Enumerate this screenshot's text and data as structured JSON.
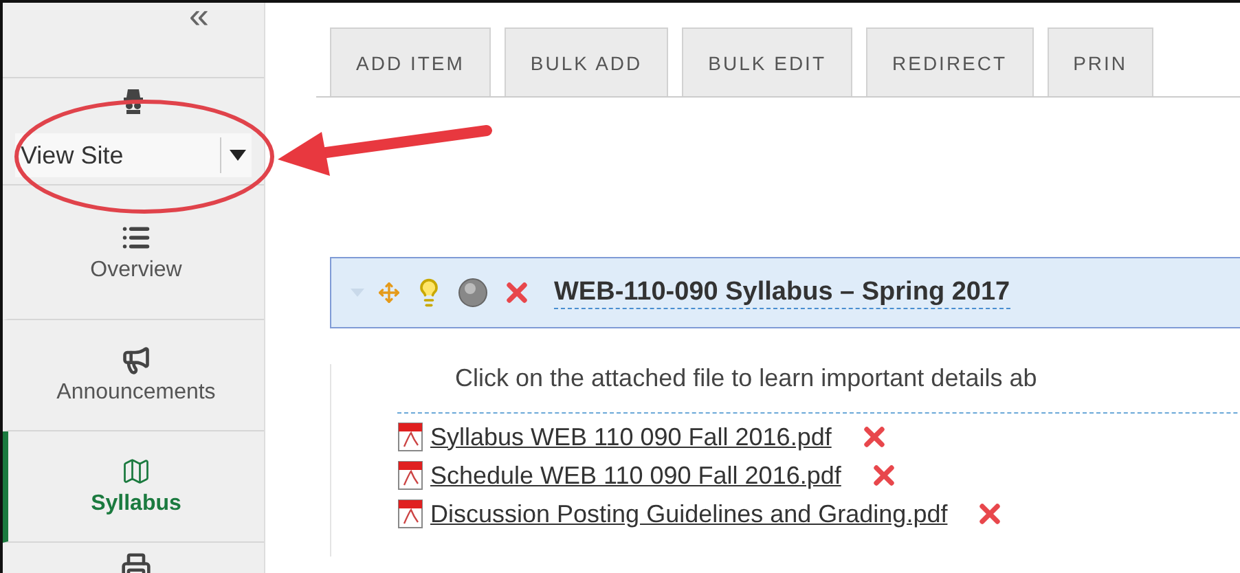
{
  "sidebar": {
    "collapse_glyph": "«",
    "site_menu": {
      "label": "View Site"
    },
    "items": [
      {
        "kind": "list",
        "label": "Overview",
        "selected": false
      },
      {
        "kind": "megaphone",
        "label": "Announcements",
        "selected": false
      },
      {
        "kind": "map",
        "label": "Syllabus",
        "selected": true
      },
      {
        "kind": "printer",
        "selected": false
      }
    ]
  },
  "toolbar": {
    "buttons": [
      "ADD ITEM",
      "BULK ADD",
      "BULK EDIT",
      "REDIRECT",
      "PRIN"
    ]
  },
  "section": {
    "title": "WEB-110-090 Syllabus – Spring 2017",
    "description": "Click on the attached file to learn important details ab",
    "attachments": [
      "Syllabus WEB 110 090 Fall 2016.pdf",
      "Schedule WEB 110 090 Fall 2016.pdf",
      "Discussion Posting Guidelines and Grading.pdf"
    ]
  }
}
